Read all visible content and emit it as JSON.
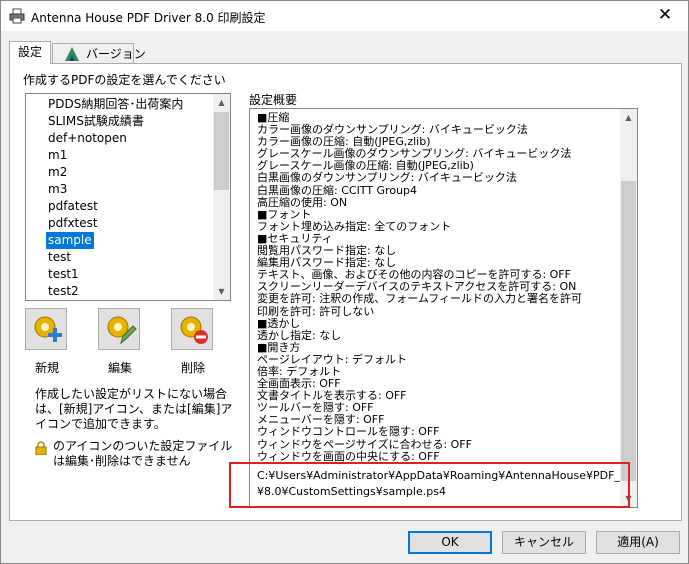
{
  "window": {
    "title": "Antenna House PDF Driver 8.0 印刷設定",
    "close_glyph": "✕"
  },
  "tabs": [
    {
      "label": "設定",
      "selected": true
    },
    {
      "label": "バージョン",
      "selected": false
    }
  ],
  "settings_list": {
    "heading": "作成するPDFの設定を選んでください",
    "items": [
      "PDDS納期回答･出荷案内",
      "SLIMS試験成績書",
      "def+notopen",
      "m1",
      "m2",
      "m3",
      "pdfatest",
      "pdfxtest",
      "sample",
      "test",
      "test1",
      "test2"
    ],
    "selected_item": "sample"
  },
  "actions": {
    "new_label": "新規",
    "edit_label": "編集",
    "delete_label": "削除"
  },
  "help_text": "作成したい設定がリストにない場合は、[新規]アイコン、または[編集]アイコンで追加できます。",
  "lock_note": "のアイコンのついた設定ファイルは編集･削除はできません",
  "summary": {
    "heading": "設定概要",
    "lines": [
      "■圧縮",
      "カラー画像のダウンサンプリング: バイキュービック法",
      "カラー画像の圧縮: 自動(JPEG,zlib)",
      "グレースケール画像のダウンサンプリング: バイキュービック法",
      "グレースケール画像の圧縮: 自動(JPEG,zlib)",
      "白黒画像のダウンサンプリング: バイキュービック法",
      "白黒画像の圧縮: CCITT Group4",
      "高圧縮の使用: ON",
      "■フォント",
      "フォント埋め込み指定: 全てのフォント",
      "■セキュリティ",
      "閲覧用パスワード指定: なし",
      "編集用パスワード指定: なし",
      "テキスト、画像、およびその他の内容のコピーを許可する: OFF",
      "スクリーンリーダーデバイスのテキストアクセスを許可する: ON",
      "変更を許可: 注釈の作成、フォームフィールドの入力と署名を許可",
      "印刷を許可: 許可しない",
      "■透かし",
      "透かし指定: なし",
      "■開き方",
      "ページレイアウト: デフォルト",
      "倍率: デフォルト",
      "全画面表示: OFF",
      "文書タイトルを表示する: OFF",
      "ツールバーを隠す: OFF",
      "メニューバーを隠す: OFF",
      "ウィンドウコントロールを隠す: OFF",
      "ウィンドウをページサイズに合わせる: OFF",
      "ウィンドウを画面の中央にする: OFF"
    ],
    "path_line_1": "C:¥Users¥Administrator¥AppData¥Roaming¥AntennaHouse¥PDF_Driver",
    "path_line_2": "¥8.0¥CustomSettings¥sample.ps4"
  },
  "buttons": {
    "ok": "OK",
    "cancel": "キャンセル",
    "apply": "適用(A)"
  },
  "colors": {
    "selection": "#0078d7",
    "highlight_border": "#e02020"
  }
}
